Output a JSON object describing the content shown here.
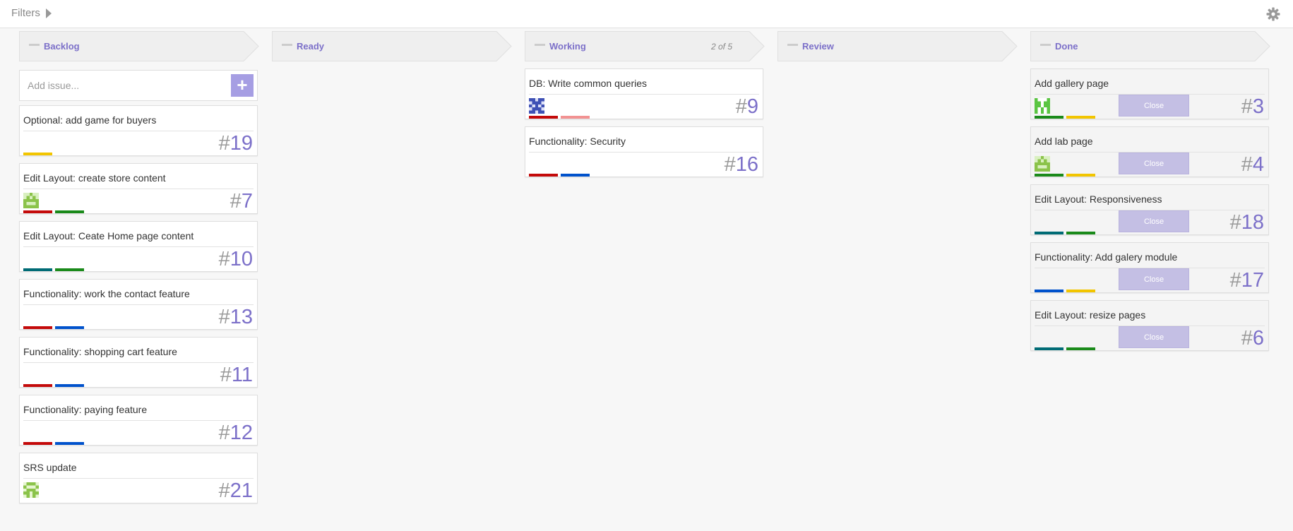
{
  "topbar": {
    "filters_label": "Filters",
    "filters_icon": "triangle-right-icon",
    "settings_icon": "gear-icon"
  },
  "colors": {
    "accent": "#7c70c9",
    "add_button": "#a69ee3",
    "close_button": "#c4bfe4",
    "header_bg": "#efefef"
  },
  "add_issue": {
    "placeholder": "Add issue...",
    "button_icon": "plus-icon"
  },
  "columns": [
    {
      "title": "Backlog",
      "wip": "",
      "cards": [
        {
          "title": "Optional: add game for buyers",
          "number": "19",
          "avatar": "",
          "labels": [
            "#f2c500"
          ]
        },
        {
          "title": "Edit Layout: create store content",
          "number": "7",
          "avatar": "avatar-green-a",
          "labels": [
            "#c40a0a",
            "#1a8a1a"
          ]
        },
        {
          "title": "Edit Layout: Ceate Home page content",
          "number": "10",
          "avatar": "",
          "labels": [
            "#006b75",
            "#1a8a1a"
          ]
        },
        {
          "title": "Functionality: work the contact feature",
          "number": "13",
          "avatar": "",
          "labels": [
            "#c40a0a",
            "#0052cc"
          ]
        },
        {
          "title": "Functionality: shopping cart feature",
          "number": "11",
          "avatar": "",
          "labels": [
            "#c40a0a",
            "#0052cc"
          ]
        },
        {
          "title": "Functionality: paying feature",
          "number": "12",
          "avatar": "",
          "labels": [
            "#c40a0a",
            "#0052cc"
          ]
        },
        {
          "title": "SRS update",
          "number": "21",
          "avatar": "avatar-green-b",
          "labels": []
        }
      ]
    },
    {
      "title": "Ready",
      "wip": "",
      "cards": []
    },
    {
      "title": "Working",
      "wip": "2 of 5",
      "cards": [
        {
          "title": "DB: Write common queries",
          "number": "9",
          "avatar": "avatar-blue",
          "labels": [
            "#c40a0a",
            "#f29292"
          ]
        },
        {
          "title": "Functionality: Security",
          "number": "16",
          "avatar": "",
          "labels": [
            "#c40a0a",
            "#0052cc"
          ]
        }
      ]
    },
    {
      "title": "Review",
      "wip": "",
      "cards": []
    },
    {
      "title": "Done",
      "wip": "",
      "cards": [
        {
          "title": "Add gallery page",
          "number": "3",
          "avatar": "avatar-green-c",
          "labels": [
            "#1a8a1a",
            "#f2c500"
          ],
          "close_label": "Close"
        },
        {
          "title": "Add lab page",
          "number": "4",
          "avatar": "avatar-green-a",
          "labels": [
            "#1a8a1a",
            "#f2c500"
          ],
          "close_label": "Close"
        },
        {
          "title": "Edit Layout: Responsiveness",
          "number": "18",
          "avatar": "",
          "labels": [
            "#006b75",
            "#1a8a1a"
          ],
          "close_label": "Close"
        },
        {
          "title": "Functionality: Add galery module",
          "number": "17",
          "avatar": "",
          "labels": [
            "#0052cc",
            "#f2c500"
          ],
          "close_label": "Close"
        },
        {
          "title": "Edit Layout: resize pages",
          "number": "6",
          "avatar": "",
          "labels": [
            "#006b75",
            "#1a8a1a"
          ],
          "close_label": "Close"
        }
      ]
    }
  ]
}
